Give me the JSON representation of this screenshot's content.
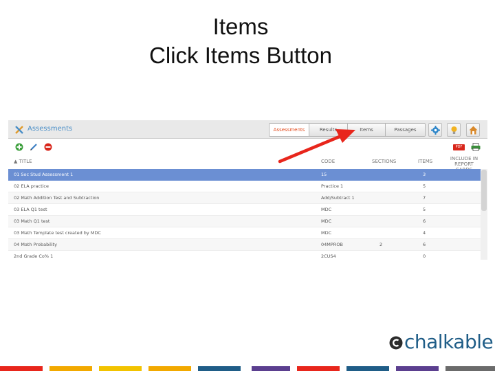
{
  "slide": {
    "title_line1": "Items",
    "title_line2": "Click Items Button"
  },
  "app": {
    "title": "Assessments",
    "tabs": [
      {
        "label": "Assessments",
        "active": true
      },
      {
        "label": "Results",
        "active": false
      },
      {
        "label": "Items",
        "active": false
      },
      {
        "label": "Passages",
        "active": false
      }
    ],
    "header_icons": [
      "gear-icon",
      "lightbulb-icon",
      "home-icon"
    ],
    "toolbar_icons": [
      "add-icon",
      "edit-icon",
      "delete-icon",
      "pdf-icon",
      "print-icon"
    ],
    "pdf_label": "PDF"
  },
  "table": {
    "columns": {
      "title": "▲ TITLE",
      "code": "CODE",
      "sections": "SECTIONS",
      "items": "ITEMS",
      "include_line1": "INCLUDE IN",
      "include_line2": "REPORT CARDS"
    },
    "rows": [
      {
        "title": "01 Soc Stud Assessment 1",
        "code": "15",
        "sections": "",
        "items": "3",
        "selected": true
      },
      {
        "title": "02 ELA practice",
        "code": "Practice 1",
        "sections": "",
        "items": "5",
        "selected": false
      },
      {
        "title": "02 Math Addition Test and Subtraction",
        "code": "Add/Subtract 1",
        "sections": "",
        "items": "7",
        "selected": false
      },
      {
        "title": "03 ELA Q1 test",
        "code": "MDC",
        "sections": "",
        "items": "5",
        "selected": false
      },
      {
        "title": "03 Math Q1 test",
        "code": "MDC",
        "sections": "",
        "items": "6",
        "selected": false
      },
      {
        "title": "03 Math Template test created by MDC",
        "code": "MDC",
        "sections": "",
        "items": "4",
        "selected": false
      },
      {
        "title": "04 Math Probability",
        "code": "04MPROB",
        "sections": "2",
        "items": "6",
        "selected": false
      },
      {
        "title": "2nd Grade Co% 1",
        "code": "2CUS4",
        "sections": "",
        "items": "0",
        "selected": false
      }
    ]
  },
  "annotation": {
    "type": "arrow",
    "color": "#e8261c",
    "points_to": "tab-items"
  },
  "logo": {
    "text": "chalkable",
    "color": "#1f5d87"
  },
  "footer_stripes": [
    "#e8261c",
    "#f2a900",
    "#f2c300",
    "#f2a900",
    "#1f5d87",
    "#5b3f8f",
    "#e8261c",
    "#1f5d87",
    "#5b3f8f",
    "#6b6b6b"
  ]
}
